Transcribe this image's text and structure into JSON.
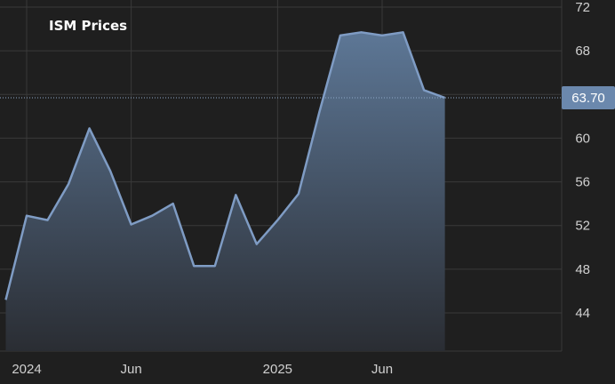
{
  "chart_data": {
    "type": "area",
    "title": "ISM Prices",
    "xlabel": "",
    "ylabel": "",
    "x": [
      "2023-12",
      "2024-01",
      "2024-02",
      "2024-03",
      "2024-04",
      "2024-05",
      "2024-06",
      "2024-07",
      "2024-08",
      "2024-09",
      "2024-10",
      "2024-11",
      "2024-12",
      "2025-01",
      "2025-02",
      "2025-03",
      "2025-04",
      "2025-05",
      "2025-06",
      "2025-07",
      "2025-08"
    ],
    "values": [
      45.2,
      52.9,
      52.5,
      55.8,
      60.9,
      57.0,
      52.1,
      52.9,
      54.0,
      48.3,
      48.3,
      54.8,
      50.3,
      52.5,
      54.9,
      62.4,
      69.4,
      69.7,
      69.4,
      69.7,
      64.4,
      63.7
    ],
    "x_full": [
      "2023-12",
      "2024-01",
      "2024-02",
      "2024-03",
      "2024-04",
      "2024-05",
      "2024-06",
      "2024-07",
      "2024-08",
      "2024-09",
      "2024-10",
      "2024-11",
      "2024-12",
      "2025-01",
      "2025-02",
      "2025-03",
      "2025-04",
      "2025-05",
      "2025-06",
      "2025-07",
      "2025-08",
      "2025-09"
    ],
    "ylim": [
      40,
      72
    ],
    "yticks": [
      44,
      48,
      52,
      56,
      60,
      64,
      68,
      72
    ],
    "xticks": [
      {
        "label": "2024",
        "date": "2024-01"
      },
      {
        "label": "Jun",
        "date": "2024-06"
      },
      {
        "label": "2025",
        "date": "2025-01"
      },
      {
        "label": "Jun",
        "date": "2025-06"
      }
    ],
    "last_value_label": "63.70",
    "grid": true,
    "legend": "none",
    "line_color": "#7f9cc4",
    "fill_top_color": "#5d7796",
    "fill_bottom_color": "#2a2d33",
    "label_bg_color": "#6b88ad"
  }
}
